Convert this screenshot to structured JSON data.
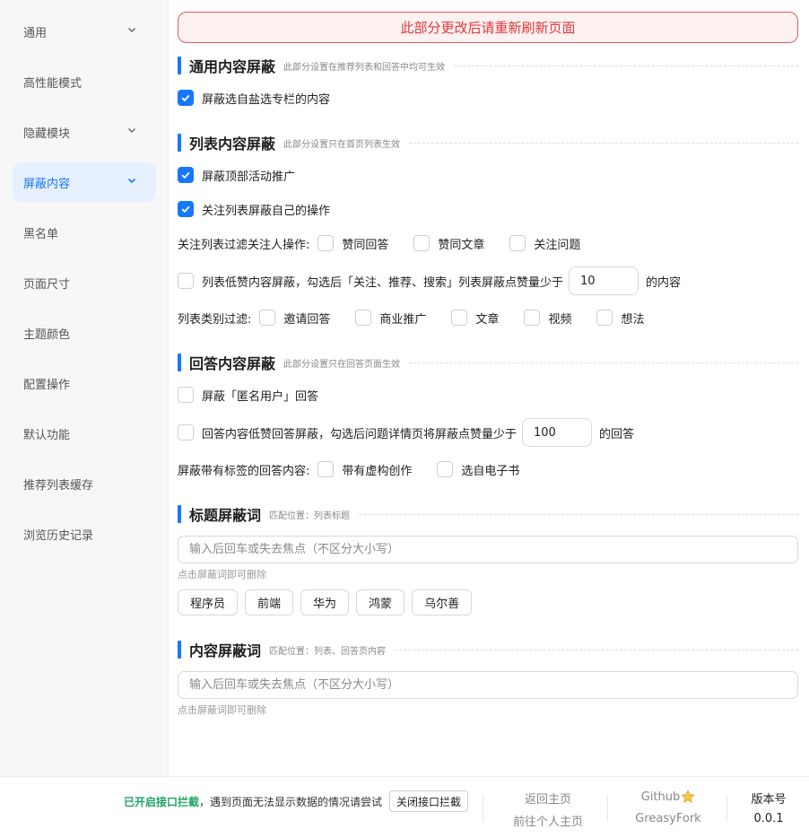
{
  "sidebar": {
    "items": [
      {
        "label": "通用",
        "expandable": true,
        "active": false
      },
      {
        "label": "高性能模式",
        "expandable": false,
        "active": false
      },
      {
        "label": "隐藏模块",
        "expandable": true,
        "active": false
      },
      {
        "label": "屏蔽内容",
        "expandable": true,
        "active": true
      },
      {
        "label": "黑名单",
        "expandable": false,
        "active": false
      },
      {
        "label": "页面尺寸",
        "expandable": false,
        "active": false
      },
      {
        "label": "主题颜色",
        "expandable": false,
        "active": false
      },
      {
        "label": "配置操作",
        "expandable": false,
        "active": false
      },
      {
        "label": "默认功能",
        "expandable": false,
        "active": false
      },
      {
        "label": "推荐列表缓存",
        "expandable": false,
        "active": false
      },
      {
        "label": "浏览历史记录",
        "expandable": false,
        "active": false
      }
    ]
  },
  "notice": "此部分更改后请重新刷新页面",
  "sections": {
    "general": {
      "title": "通用内容屏蔽",
      "desc": "此部分设置在推荐列表和回答中均可生效",
      "options": [
        {
          "label": "屏蔽选自盐选专栏的内容",
          "checked": true
        }
      ]
    },
    "list": {
      "title": "列表内容屏蔽",
      "desc": "此部分设置只在首页列表生效",
      "options": [
        {
          "label": "屏蔽顶部活动推广",
          "checked": true
        },
        {
          "label": "关注列表屏蔽自己的操作",
          "checked": true
        }
      ],
      "follow_filter": {
        "label": "关注列表过滤关注人操作:",
        "options": [
          {
            "label": "赞同回答",
            "checked": false
          },
          {
            "label": "赞同文章",
            "checked": false
          },
          {
            "label": "关注问题",
            "checked": false
          }
        ]
      },
      "low_vote": {
        "checked": false,
        "prefix": "列表低赞内容屏蔽，勾选后「关注、推荐、搜索」列表屏蔽点赞量少于",
        "value": "10",
        "suffix": "的内容"
      },
      "type_filter": {
        "label": "列表类别过滤:",
        "options": [
          {
            "label": "邀请回答",
            "checked": false
          },
          {
            "label": "商业推广",
            "checked": false
          },
          {
            "label": "文章",
            "checked": false
          },
          {
            "label": "视频",
            "checked": false
          },
          {
            "label": "想法",
            "checked": false
          }
        ]
      }
    },
    "answer": {
      "title": "回答内容屏蔽",
      "desc": "此部分设置只在回答页面生效",
      "options": [
        {
          "label": "屏蔽「匿名用户」回答",
          "checked": false
        }
      ],
      "low_vote": {
        "checked": false,
        "prefix": "回答内容低赞回答屏蔽，勾选后问题详情页将屏蔽点赞量少于",
        "value": "100",
        "suffix": "的回答"
      },
      "tag_filter": {
        "label": "屏蔽带有标签的回答内容:",
        "options": [
          {
            "label": "带有虚构创作",
            "checked": false
          },
          {
            "label": "选自电子书",
            "checked": false
          }
        ]
      }
    },
    "title_words": {
      "title": "标题屏蔽词",
      "desc": "匹配位置：列表标题",
      "placeholder": "输入后回车或失去焦点（不区分大小写）",
      "hint": "点击屏蔽词即可删除",
      "tags": [
        "程序员",
        "前端",
        "华为",
        "鸿蒙",
        "乌尔善"
      ]
    },
    "content_words": {
      "title": "内容屏蔽词",
      "desc": "匹配位置：列表、回答页内容",
      "placeholder": "输入后回车或失去焦点（不区分大小写）",
      "hint": "点击屏蔽词即可删除"
    }
  },
  "footer": {
    "api_on": "已开启接口拦截",
    "api_note": "，遇到页面无法显示数据的情况请尝试",
    "api_button": "关闭接口拦截",
    "home": "返回主页",
    "profile": "前往个人主页",
    "github": "Github",
    "greasyfork": "GreasyFork",
    "version_label": "版本号",
    "version": "0.0.1"
  },
  "colors": {
    "accent": "#1677ff",
    "danger": "#e0393a",
    "success": "#21a366"
  }
}
